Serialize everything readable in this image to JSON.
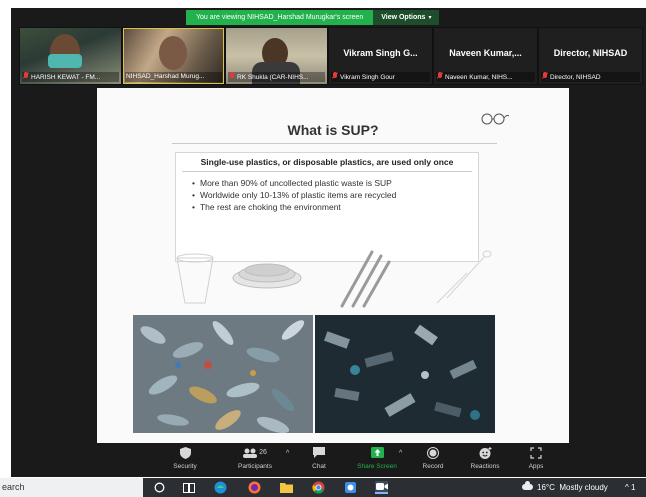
{
  "banner": {
    "message": "You are viewing NIHSAD_Harshad Murugkar's screen",
    "view_options_label": "View Options",
    "view_options_icon": "chevron-down-icon"
  },
  "participants": [
    {
      "label": "HARISH KEWAT - FM...",
      "muted": true,
      "type": "video"
    },
    {
      "label": "NIHSAD_Harshad Murug...",
      "muted": false,
      "type": "video"
    },
    {
      "label": "RK Shukla (CAR-NIHS...",
      "muted": true,
      "type": "video"
    },
    {
      "display_name": "Vikram Singh G...",
      "label": "Vikram Singh Gour",
      "muted": true,
      "type": "name"
    },
    {
      "display_name": "Naveen Kumar,...",
      "label": "Naveen Kumar, NIHS...",
      "muted": true,
      "type": "name"
    },
    {
      "display_name": "Director, NIHSAD",
      "label": "Director, NIHSAD",
      "muted": true,
      "type": "name"
    }
  ],
  "slide": {
    "title": "What is SUP?",
    "definition": "Single-use plastics, or disposable plastics, are used only once",
    "bullets": [
      "More than 90% of uncollected plastic waste is SUP",
      "Worldwide only 10-13% of plastic items are recycled",
      "The rest are choking the environment"
    ]
  },
  "toolbar": {
    "security": "Security",
    "participants": "Participants",
    "participants_count": "26",
    "chat": "Chat",
    "share_screen": "Share Screen",
    "record": "Record",
    "reactions": "Reactions",
    "apps": "Apps",
    "share_color": "#22b14c"
  },
  "taskbar": {
    "search_text": "earch",
    "weather_temp": "16°C",
    "weather_desc": "Mostly cloudy",
    "tray_caret": "^",
    "tray_lang": "1"
  }
}
